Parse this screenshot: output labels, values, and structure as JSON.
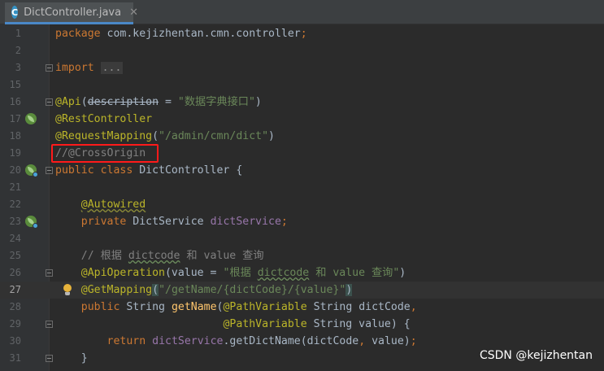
{
  "tab": {
    "label": "DictController.java",
    "icon": "java-class-icon",
    "icon_letter": "C",
    "close": "✕"
  },
  "lines": [
    {
      "num": "1",
      "code": "package com.kejizhentan.cmn.controller;"
    },
    {
      "num": "2",
      "code": ""
    },
    {
      "num": "3",
      "code": "import ..."
    },
    {
      "num": "15",
      "code": ""
    },
    {
      "num": "16",
      "code": "@Api(description = \"数据字典接口\")"
    },
    {
      "num": "17",
      "code": "@RestController"
    },
    {
      "num": "18",
      "code": "@RequestMapping(\"/admin/cmn/dict\")"
    },
    {
      "num": "19",
      "code": "//@CrossOrigin"
    },
    {
      "num": "20",
      "code": "public class DictController {"
    },
    {
      "num": "21",
      "code": ""
    },
    {
      "num": "22",
      "code": "    @Autowired"
    },
    {
      "num": "23",
      "code": "    private DictService dictService;"
    },
    {
      "num": "24",
      "code": ""
    },
    {
      "num": "25",
      "code": "    // 根据 dictcode 和 value 查询"
    },
    {
      "num": "26",
      "code": "    @ApiOperation(value = \"根据 dictcode 和 value 查询\")"
    },
    {
      "num": "27",
      "code": "    @GetMapping(\"/getName/{dictCode}/{value}\")"
    },
    {
      "num": "28",
      "code": "    public String getName(@PathVariable String dictCode,"
    },
    {
      "num": "29",
      "code": "                          @PathVariable String value) {"
    },
    {
      "num": "30",
      "code": "        return dictService.getDictName(dictCode, value);"
    },
    {
      "num": "31",
      "code": "    }"
    }
  ],
  "current_line": "27",
  "watermark": "CSDN @kejizhentan",
  "colors": {
    "background": "#2b2b2b",
    "gutter": "#313335",
    "keyword": "#cc7832",
    "annotation": "#bbb529",
    "string": "#6a8759",
    "comment": "#808080",
    "field": "#9876aa",
    "method": "#ffc66d",
    "highlight_box": "#ff1a1a"
  }
}
